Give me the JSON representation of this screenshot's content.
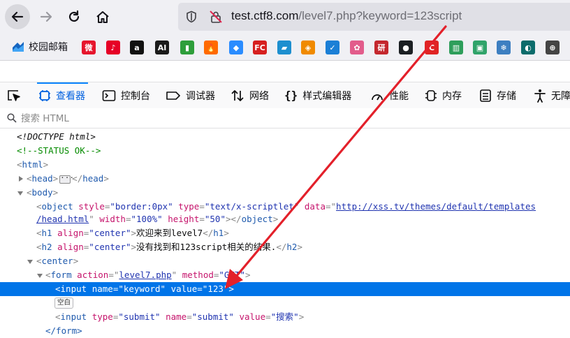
{
  "browser": {
    "url_host": "test.ctf8.com",
    "url_path": "/level7.php?keyword=123script"
  },
  "bookmarks": {
    "first_label": "校园邮箱",
    "icons": [
      {
        "name": "weibo-icon",
        "glyph": "微",
        "color": "#e6162d"
      },
      {
        "name": "netease-music-icon",
        "glyph": "♪",
        "color": "#e60026"
      },
      {
        "name": "amazon-icon",
        "glyph": "a",
        "color": "#111111"
      },
      {
        "name": "ai-icon",
        "glyph": "AI",
        "color": "#1a1a1a"
      },
      {
        "name": "green-book-icon",
        "glyph": "▮",
        "color": "#2e9e3b"
      },
      {
        "name": "fire-icon",
        "glyph": "🔥",
        "color": "#ff6a00"
      },
      {
        "name": "cube-icon",
        "glyph": "◆",
        "color": "#2a8cff"
      },
      {
        "name": "fc-icon",
        "glyph": "FC",
        "color": "#d61f1f"
      },
      {
        "name": "book-icon",
        "glyph": "▰",
        "color": "#1d8fcf"
      },
      {
        "name": "orange-icon",
        "glyph": "◈",
        "color": "#f08a00"
      },
      {
        "name": "check-icon",
        "glyph": "✓",
        "color": "#1b7fd6"
      },
      {
        "name": "flower-icon",
        "glyph": "✿",
        "color": "#e25c8b"
      },
      {
        "name": "seal-icon",
        "glyph": "研",
        "color": "#c4282e"
      },
      {
        "name": "github-icon",
        "glyph": "●",
        "color": "#1b1f23"
      },
      {
        "name": "c-icon",
        "glyph": "C",
        "color": "#e02424"
      },
      {
        "name": "layers-icon",
        "glyph": "▥",
        "color": "#2e9e5b"
      },
      {
        "name": "vault-icon",
        "glyph": "▣",
        "color": "#30a36a"
      },
      {
        "name": "snowflake-icon",
        "glyph": "❄",
        "color": "#3d7fc1"
      },
      {
        "name": "circle-icon",
        "glyph": "◐",
        "color": "#0b6b6b"
      },
      {
        "name": "globe-icon",
        "glyph": "⊕",
        "color": "#444444"
      }
    ]
  },
  "devtools": {
    "tabs": [
      {
        "id": "inspector",
        "label": "查看器",
        "icon": "inspector-icon",
        "selected": true
      },
      {
        "id": "console",
        "label": "控制台",
        "icon": "console-icon"
      },
      {
        "id": "debugger",
        "label": "调试器",
        "icon": "debugger-icon"
      },
      {
        "id": "network",
        "label": "网络",
        "icon": "network-icon"
      },
      {
        "id": "style-editor",
        "label": "样式编辑器",
        "icon": "braces-icon"
      },
      {
        "id": "performance",
        "label": "性能",
        "icon": "gauge-icon"
      },
      {
        "id": "memory",
        "label": "内存",
        "icon": "memory-icon"
      },
      {
        "id": "storage",
        "label": "存储",
        "icon": "storage-icon"
      },
      {
        "id": "accessibility",
        "label": "无障",
        "icon": "accessibility-icon"
      }
    ],
    "search_placeholder": "搜索 HTML"
  },
  "markup": {
    "doctype": "<!DOCTYPE html>",
    "comment": "<!--STATUS OK-->",
    "html_tag": "html",
    "head_tag": "head",
    "body_tag": "body",
    "object": {
      "tag": "object",
      "style_attr": "style",
      "style_val": "\"border:0px\"",
      "type_attr": "type",
      "type_val": "\"text/x-scriptlet\"",
      "data_attr": "data",
      "data_link_1": "http://xss.tv/themes/default/templates",
      "data_link_2": "/head.html",
      "width_attr": "width",
      "width_val": "\"100%\"",
      "height_attr": "height",
      "height_val": "\"50\""
    },
    "h1": {
      "tag": "h1",
      "attr": "align",
      "val": "\"center\"",
      "text": "欢迎来到level7"
    },
    "h2": {
      "tag": "h2",
      "attr": "align",
      "val": "\"center\"",
      "text": "没有找到和123script相关的结果."
    },
    "center_tag": "center",
    "form": {
      "tag": "form",
      "action_attr": "action",
      "action_val": "level7.php",
      "method_attr": "method",
      "method_val": "\"GET\""
    },
    "input1": {
      "tag": "input",
      "name_attr": "name",
      "name_val": "\"keyword\"",
      "value_attr": "value",
      "value_val": "\"123\""
    },
    "whitespace_badge": "空白",
    "input2": {
      "tag": "input",
      "type_attr": "type",
      "type_val": "\"submit\"",
      "name_attr": "name",
      "name_val": "\"submit\"",
      "value_attr": "value",
      "value_val": "\"搜索\""
    },
    "form_close": "</form>"
  },
  "colors": {
    "selection": "#0074e8",
    "tag": "#1f5aad",
    "attr": "#c5136b",
    "value": "#2034b0",
    "annotation_arrow": "#e3202a"
  }
}
